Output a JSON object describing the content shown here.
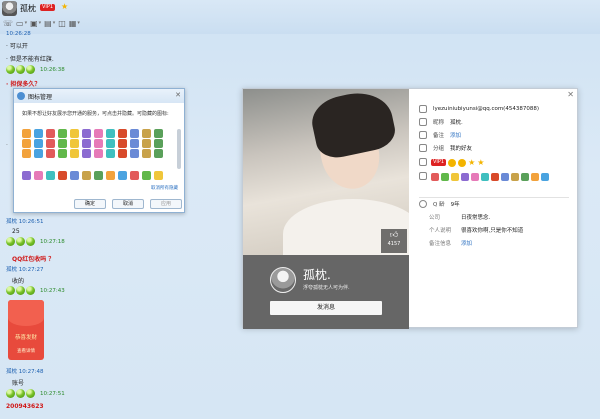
{
  "header": {
    "contact_name": "孤枕",
    "vip_badge": "VIP1",
    "star_icon": "star-icon"
  },
  "toolbar": {
    "items": [
      "phone-icon",
      "video-icon",
      "screen-share-icon",
      "folder-icon",
      "remote-icon",
      "app-icon"
    ]
  },
  "chat": {
    "messages": [
      {
        "kind": "meta",
        "text": "10:26:28"
      },
      {
        "kind": "text",
        "text": "· 可以开"
      },
      {
        "kind": "text",
        "text": "· 但是不能有红旗."
      },
      {
        "kind": "time",
        "text": "10:26:38"
      },
      {
        "kind": "red",
        "text": "· 担保多久？"
      },
      {
        "kind": "meta",
        "text": "孤枕  10:26:51"
      },
      {
        "kind": "text",
        "text": "25"
      },
      {
        "kind": "time",
        "text": "10:27:18"
      },
      {
        "kind": "red",
        "text": "QQ红包收吗 ？"
      },
      {
        "kind": "meta",
        "text": "孤枕  10:27:27"
      },
      {
        "kind": "text",
        "text": "收的"
      },
      {
        "kind": "time",
        "text": "10:27:43"
      },
      {
        "kind": "meta",
        "text": "孤枕  10:27:48"
      },
      {
        "kind": "text",
        "text": "账号"
      },
      {
        "kind": "time",
        "text": "10:27:51"
      },
      {
        "kind": "red",
        "text": "200943623"
      }
    ],
    "red_envelope": {
      "title": "恭喜发财",
      "sub": "查看详情"
    }
  },
  "emoji_dialog": {
    "title": "图标管理",
    "desc": "如果不想让好友展示您开通的服务，可点击并隐藏。可隐藏的图标:",
    "link": "取消所有隐藏",
    "buttons": {
      "ok": "确定",
      "cancel": "取消",
      "apply": "应用"
    },
    "colors": [
      "#f2a23c",
      "#4aa3e0",
      "#e25b5b",
      "#61b84a",
      "#f0c63a",
      "#8c6bd1",
      "#e67ab8",
      "#3fbfbf",
      "#d84a2a",
      "#6a8ad6",
      "#c8a24a",
      "#5aa05a"
    ]
  },
  "profile": {
    "likes": "4157",
    "nickname": "孤枕.",
    "signature": "浮夸孤枕无人可为伴.",
    "send_button": "发消息",
    "email": "lyezuiniubiyunsi@qq.com(454387088)",
    "remark_label": "昵称",
    "remark_value": "孤枕.",
    "note_label": "备注",
    "note_link": "添加",
    "group_label": "分组",
    "group_value": "我的好友",
    "badge": "VIP1",
    "age_label": "Q 龄",
    "age_value": "9年",
    "company_label": "公司",
    "company_value": "日夜常思念.",
    "bio_label": "个人说明",
    "bio_value": "很喜欢你啊,只是你不知道",
    "memo_label": "备注信息",
    "memo_link": "添加"
  }
}
